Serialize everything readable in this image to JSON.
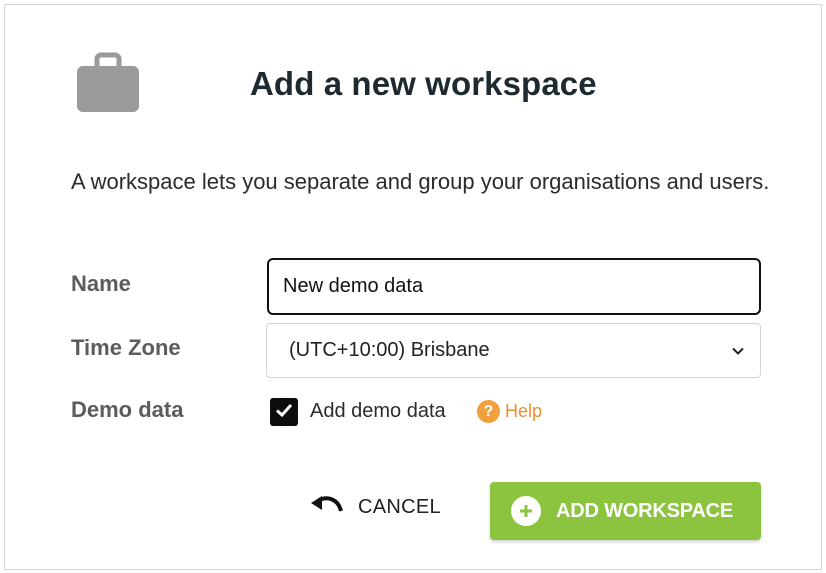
{
  "dialog": {
    "title": "Add a new workspace",
    "description": "A workspace lets you separate and group your organisations and users.",
    "icon": "briefcase-icon"
  },
  "form": {
    "name_label": "Name",
    "name_value": "New demo data",
    "timezone_label": "Time Zone",
    "timezone_value": "(UTC+10:00) Brisbane",
    "demo_label": "Demo data",
    "demo_checkbox_label": "Add demo data",
    "demo_checked": true,
    "help_label": "Help"
  },
  "actions": {
    "cancel_label": "CANCEL",
    "add_label": "ADD WORKSPACE"
  },
  "colors": {
    "primary_button": "#8cc43f",
    "help_accent": "#f0a03c",
    "icon_gray": "#9a9a9a"
  }
}
